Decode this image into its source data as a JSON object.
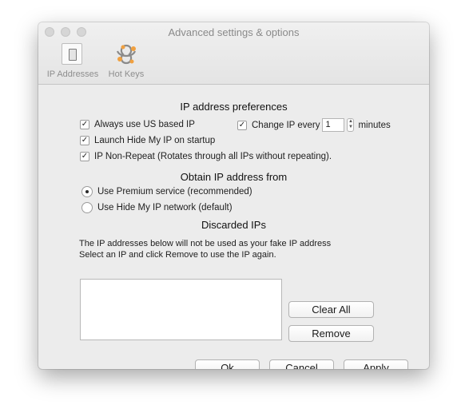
{
  "window": {
    "title": "Advanced settings & options"
  },
  "toolbar": {
    "items": [
      {
        "label": "IP Addresses",
        "icon": "switch-icon"
      },
      {
        "label": "Hot Keys",
        "icon": "hotkeys-icon"
      }
    ]
  },
  "ip_prefs": {
    "title": "IP address preferences",
    "always_us": {
      "label": "Always use US based IP",
      "checked": true
    },
    "change_ip": {
      "label": "Change IP every",
      "checked": true,
      "value": "1",
      "unit": "minutes"
    },
    "launch_startup": {
      "label": "Launch Hide My IP on startup",
      "checked": true
    },
    "non_repeat": {
      "label": "IP Non-Repeat (Rotates through all IPs without repeating).",
      "checked": true
    }
  },
  "obtain": {
    "title": "Obtain IP address from",
    "options": [
      {
        "label": "Use Premium service (recommended)",
        "selected": true
      },
      {
        "label": "Use Hide My IP network (default)",
        "selected": false
      }
    ]
  },
  "discarded": {
    "title": "Discarded IPs",
    "line1": "The IP addresses below will not be used as your fake IP address",
    "line2": "Select an IP and click Remove to use the IP again.",
    "clear_all": "Clear All",
    "remove": "Remove"
  },
  "footer": {
    "ok": "Ok",
    "cancel": "Cancel",
    "apply": "Apply"
  },
  "colors": {
    "window_bg": "#ececec",
    "hotkeys_accent": "#f0a040"
  }
}
